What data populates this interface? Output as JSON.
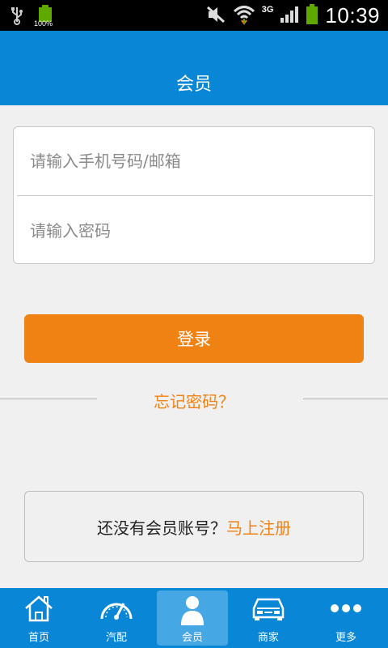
{
  "status_bar": {
    "battery_left_percent": "100%",
    "network": "3G",
    "time": "10:39"
  },
  "header": {
    "title": "会员"
  },
  "login": {
    "account_placeholder": "请输入手机号码/邮箱",
    "password_placeholder": "请输入密码",
    "login_button": "登录",
    "forgot_password": "忘记密码？"
  },
  "register": {
    "prompt": "还没有会员账号？",
    "link": "马上注册"
  },
  "tabbar": {
    "items": [
      {
        "label": "首页",
        "icon": "home-icon"
      },
      {
        "label": "汽配",
        "icon": "speedometer-icon"
      },
      {
        "label": "会员",
        "icon": "member-icon",
        "active": true
      },
      {
        "label": "商家",
        "icon": "car-icon"
      },
      {
        "label": "更多",
        "icon": "more-icon"
      }
    ]
  },
  "colors": {
    "primary_blue": "#0a86d6",
    "accent_orange": "#f08214",
    "background": "#f0f0f0"
  }
}
